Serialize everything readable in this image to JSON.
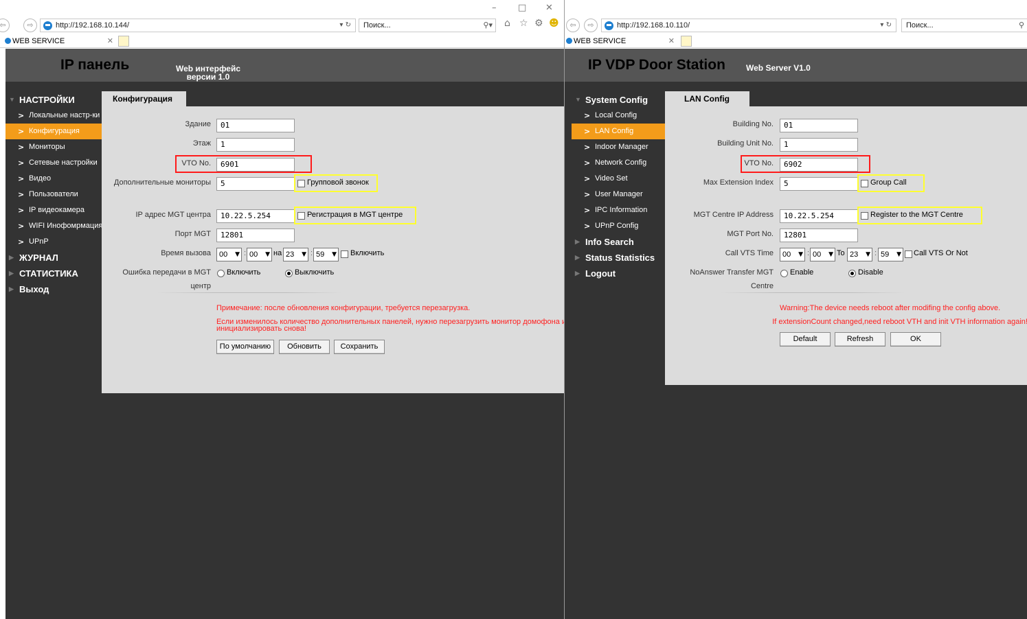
{
  "left": {
    "browser": {
      "url": "http://192.168.10.144/",
      "search_placeholder": "Поиск...",
      "tab_title": "WEB SERVICE"
    },
    "header": {
      "title": "IP панель",
      "subtitle_line1": "Web интерфейс",
      "subtitle_line2": "версии 1.0"
    },
    "menu": {
      "sections": [
        "НАСТРОЙКИ",
        "ЖУРНАЛ",
        "СТАТИСТИКА",
        "Выход"
      ],
      "items": [
        "Локальные настр-ки",
        "Конфигурация",
        "Мониторы",
        "Сетевые настройки",
        "Видео",
        "Пользователи",
        "IP видеокамера",
        "WIFI Инофомрмация",
        "UPnP"
      ]
    },
    "panel_title": "Конфигурация",
    "form": {
      "building_label": "Здание",
      "building_value": "01",
      "floor_label": "Этаж",
      "floor_value": "1",
      "vto_label": "VTO No.",
      "vto_value": "6901",
      "extra_label": "Дополнительные мониторы",
      "extra_value": "5",
      "group_call": "Групповой звонок",
      "mgt_ip_label": "IP адрес MGT центра",
      "mgt_ip_value": "10.22.5.254",
      "register_mgt": "Регистрация в MGT центре",
      "mgt_port_label": "Порт MGT",
      "mgt_port_value": "12801",
      "call_time_label": "Время вызова",
      "t1": "00",
      "t2": "00",
      "to_word": "на",
      "t3": "23",
      "t4": "59",
      "enable_word": "Включить",
      "noanswer_label_1": "Ошибка передачи в MGT",
      "noanswer_label_2": "центр",
      "radio_enable": "Включить",
      "radio_disable": "Выключить"
    },
    "warnings": {
      "w1": "Примечание: после обновления конфигурации, требуется перезагрузка.",
      "w2a": "Если изменилось количество дополнительных панелей, нужно перезагрузить монитор домофона и",
      "w2b": "инициализировать снова!"
    },
    "buttons": {
      "default": "По умолчанию",
      "refresh": "Обновить",
      "save": "Сохранить"
    }
  },
  "right": {
    "browser": {
      "url": "http://192.168.10.110/",
      "search_placeholder": "Поиск...",
      "tab_title": "WEB SERVICE"
    },
    "header": {
      "title": "IP VDP Door Station",
      "subtitle": "Web Server V1.0"
    },
    "menu": {
      "sections": [
        "System Config",
        "Info Search",
        "Status Statistics",
        "Logout"
      ],
      "items": [
        "Local Config",
        "LAN Config",
        "Indoor Manager",
        "Network Config",
        "Video Set",
        "User Manager",
        "IPC Information",
        "UPnP Config"
      ]
    },
    "panel_title": "LAN Config",
    "form": {
      "building_label": "Building No.",
      "building_value": "01",
      "unit_label": "Building Unit No.",
      "unit_value": "1",
      "vto_label": "VTO No.",
      "vto_value": "6902",
      "ext_label": "Max Extension Index",
      "ext_value": "5",
      "group_call": "Group Call",
      "mgt_ip_label": "MGT Centre IP Address",
      "mgt_ip_value": "10.22.5.254",
      "register_mgt": "Register to the MGT Centre",
      "mgt_port_label": "MGT Port No.",
      "mgt_port_value": "12801",
      "call_time_label": "Call VTS Time",
      "t1": "00",
      "t2": "00",
      "to_word": "To",
      "t3": "23",
      "t4": "59",
      "call_vts": "Call VTS Or Not",
      "noanswer_label_1": "NoAnswer Transfer MGT",
      "noanswer_label_2": "Centre",
      "radio_enable": "Enable",
      "radio_disable": "Disable"
    },
    "warnings": {
      "w1": "Warning:The device needs reboot after modifing the config above.",
      "w2": "If extensionCount changed,need reboot VTH and init VTH information again!"
    },
    "buttons": {
      "default": "Default",
      "refresh": "Refresh",
      "ok": "OK"
    }
  },
  "colors": {
    "accent": "#f39c1a",
    "header": "#555555",
    "page_bg": "#333333",
    "panel": "#dcdcdc",
    "warning": "#ff2020",
    "highlight_red": "#ff1a1a",
    "highlight_yellow": "#ffff2e"
  }
}
